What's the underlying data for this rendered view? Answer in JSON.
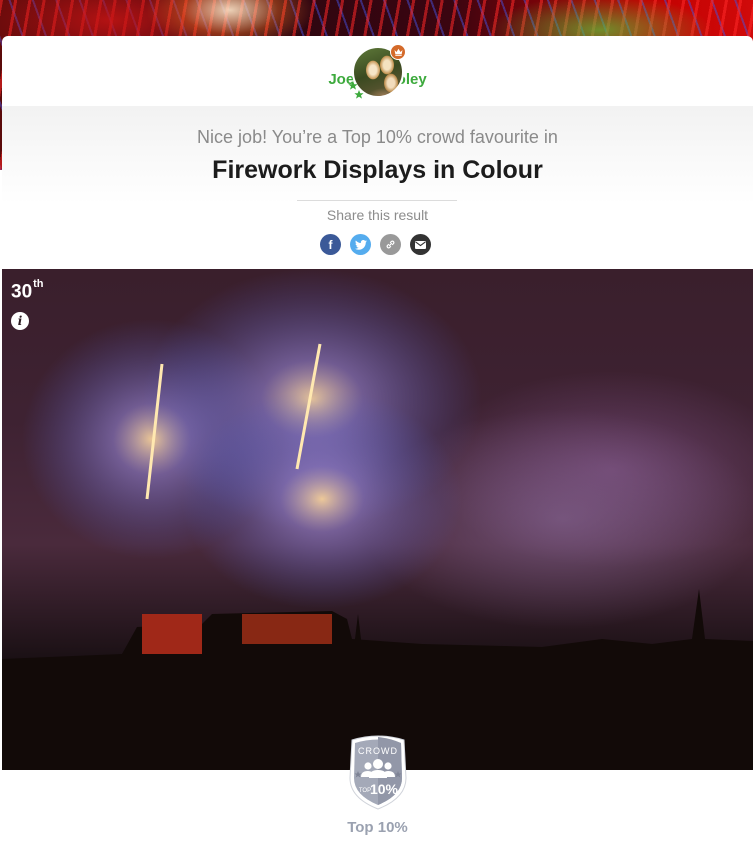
{
  "user": {
    "name": "Joe Gilhooley",
    "avatar": "owl-avatar",
    "badge_icon": "crown-icon",
    "status_icon": "stars-icon"
  },
  "result": {
    "intro": "Nice job! You’re a Top 10% crowd favourite in",
    "category": "Firework Displays in Colour"
  },
  "share": {
    "label": "Share this result",
    "buttons": [
      {
        "name": "facebook",
        "icon": "facebook-icon",
        "glyph": "f",
        "color": "#3b5998"
      },
      {
        "name": "twitter",
        "icon": "twitter-icon",
        "glyph": "",
        "color": "#55acee"
      },
      {
        "name": "copy-link",
        "icon": "link-icon",
        "glyph": "",
        "color": "#999999"
      },
      {
        "name": "email",
        "icon": "envelope-icon",
        "glyph": "",
        "color": "#333333"
      }
    ]
  },
  "photo": {
    "rank_number": "30",
    "rank_suffix": "th",
    "info_glyph": "i"
  },
  "award": {
    "badge_top": "CROWD",
    "badge_small": "TOP",
    "badge_big": "10%",
    "label": "Top 10%"
  },
  "colors": {
    "username": "#3daa3d",
    "award_label": "#9aa1b0",
    "crown_badge": "#d46a2a"
  }
}
